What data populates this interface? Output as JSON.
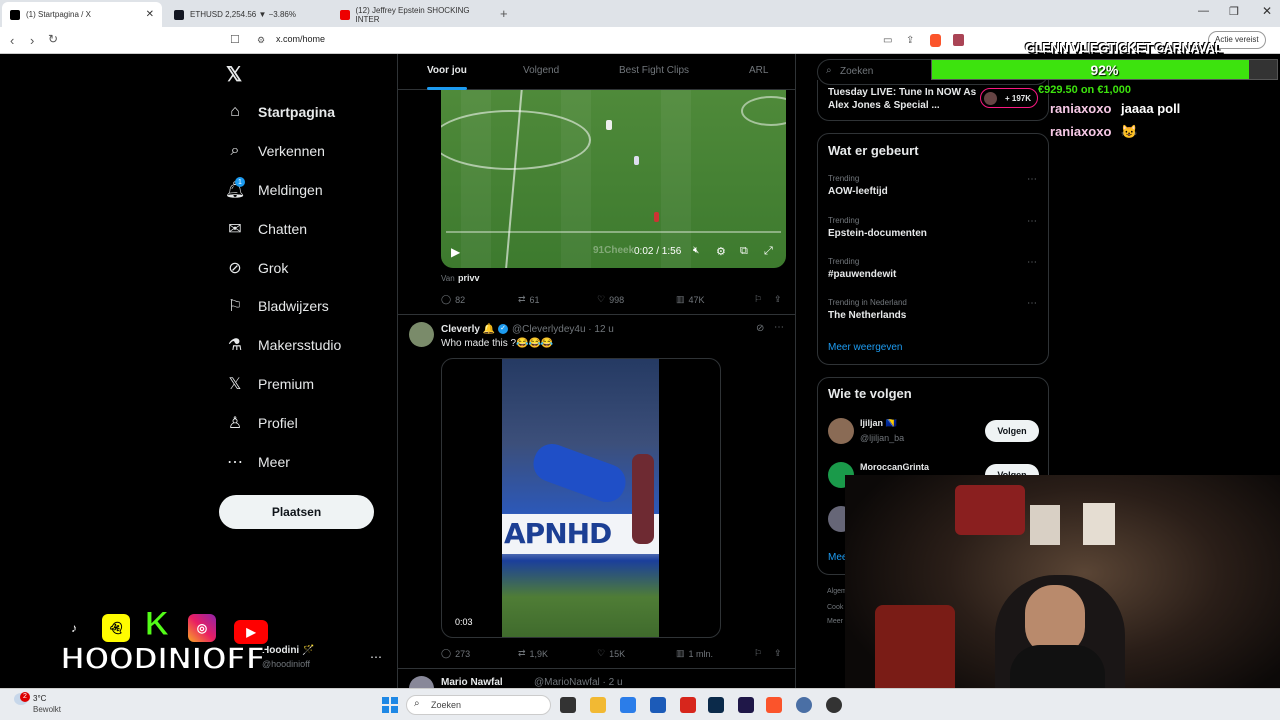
{
  "browser": {
    "tabs": [
      {
        "title": "(1) Startpagina / X",
        "active": true
      },
      {
        "title": "ETHUSD 2,254.56 ▼ −3.86%",
        "active": false
      },
      {
        "title": "(12) Jeffrey Epstein SHOCKING INTER",
        "active": false
      }
    ],
    "url": "x.com/home",
    "actie_label": "Actie vereist"
  },
  "sidebar": {
    "items": [
      {
        "label": "Startpagina",
        "icon": "home-icon"
      },
      {
        "label": "Verkennen",
        "icon": "search-icon"
      },
      {
        "label": "Meldingen",
        "icon": "bell-icon",
        "badge": "1"
      },
      {
        "label": "Chatten",
        "icon": "mail-icon"
      },
      {
        "label": "Grok",
        "icon": "grok-icon"
      },
      {
        "label": "Bladwijzers",
        "icon": "bookmark-icon"
      },
      {
        "label": "Makersstudio",
        "icon": "flask-icon"
      },
      {
        "label": "Premium",
        "icon": "x-icon"
      },
      {
        "label": "Profiel",
        "icon": "person-icon"
      },
      {
        "label": "Meer",
        "icon": "more-icon"
      }
    ],
    "post_label": "Plaatsen",
    "account": {
      "name": "Hoodini 🪄",
      "handle": "@hoodinioff"
    }
  },
  "feed": {
    "tabs": [
      "Voor jou",
      "Volgend",
      "Best Fight Clips",
      "ARL"
    ],
    "post1": {
      "video_time": "0:02 / 1:56",
      "watermark": "91Cheek",
      "from_label": "Van",
      "from_user": "privv",
      "replies": "82",
      "reposts": "61",
      "likes": "998",
      "views": "47K"
    },
    "post2": {
      "name": "Cleverly 🔔",
      "handle": "@Cleverlydey4u · 12 u",
      "text": "Who made this ?😂😂😂",
      "video_time": "0:03",
      "replies": "273",
      "reposts": "1,9K",
      "likes": "15K",
      "views": "1 mln."
    },
    "post3": {
      "name": "Mario Nawfal",
      "handle": "@MarioNawfal · 2 u"
    }
  },
  "right": {
    "search_placeholder": "Zoeken",
    "live": {
      "text": "Tuesday LIVE: Tune In NOW As Alex Jones & Special ...",
      "count": "+ 197K"
    },
    "trends_title": "Wat er gebeurt",
    "trends": [
      {
        "category": "Trending",
        "name": "AOW-leeftijd"
      },
      {
        "category": "Trending",
        "name": "Epstein-documenten"
      },
      {
        "category": "Trending",
        "name": "#pauwendewit"
      },
      {
        "category": "Trending in Nederland",
        "name": "The Netherlands"
      }
    ],
    "show_more": "Meer weergeven",
    "follow_title": "Wie te volgen",
    "follow": [
      {
        "name": "ljiljan 🇧🇦",
        "handle": "@ljiljan_ba",
        "button": "Volgen"
      },
      {
        "name": "MoroccanGrinta",
        "handle": "",
        "button": "Volgen"
      }
    ],
    "meer_partial": "Mee",
    "footer_partial": [
      "Algem",
      "Cook",
      "Meer"
    ]
  },
  "overlay": {
    "banner": "GLENN VLIEGTICKET CARNAVAL",
    "progress_value": 0.92,
    "progress_label": "92%",
    "donation": "€929.50 on €1,000",
    "chat": [
      {
        "user": "raniaxoxo",
        "msg": "jaaaa poll"
      },
      {
        "user": "raniaxoxo",
        "msg": "😺"
      }
    ],
    "streamer_name": "HOODINIOFF",
    "socials": [
      "TikTok",
      "Snapchat",
      "K",
      "Instagram",
      "YouTube"
    ]
  },
  "taskbar": {
    "weather_temp": "3°C",
    "weather_desc": "Bewolkt",
    "weather_badge": "2",
    "search_placeholder": "Zoeken"
  },
  "colors": {
    "accent": "#1d9bf0",
    "progress": "#3de30e",
    "donation": "#3de30e"
  }
}
